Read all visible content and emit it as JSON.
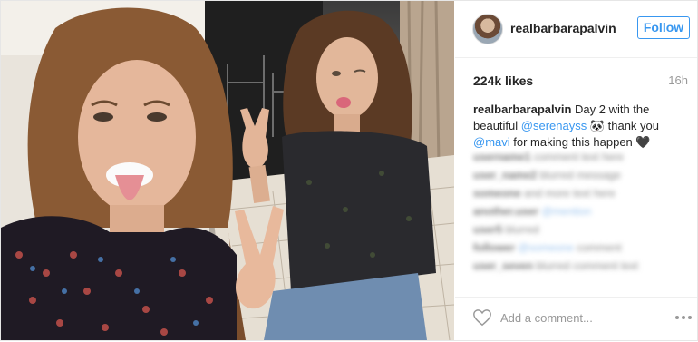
{
  "post": {
    "username": "realbarbarapalvin",
    "follow_label": "Follow",
    "likes": "224k likes",
    "time": "16h",
    "caption": {
      "author": "realbarbarapalvin",
      "text1": " Day 2 with the beautiful ",
      "mention1": "@serenayss",
      "text2": " 🐼 thank you ",
      "mention2": "@mavi",
      "text3": " for making this happen 🖤"
    },
    "comment_placeholder": "Add a comment...",
    "comments": [
      {
        "user": "username1",
        "text": " comment text here"
      },
      {
        "user": "user_name2",
        "text": " blurred message"
      },
      {
        "user": "someone",
        "text": " and more text here"
      },
      {
        "user": "another.user",
        "text": " ",
        "mention": "@mention"
      },
      {
        "user": "user5",
        "text": " blurred"
      },
      {
        "user": "follower",
        "text": " ",
        "mention": "@someone",
        "tail": " comment"
      },
      {
        "user": "user_seven",
        "text": " blurred comment text"
      }
    ]
  },
  "icons": {
    "like": "heart-icon",
    "more": "more-options-icon"
  },
  "colors": {
    "link_blue": "#3897f0",
    "border": "#e6e6e6",
    "secondary_text": "#999999"
  }
}
